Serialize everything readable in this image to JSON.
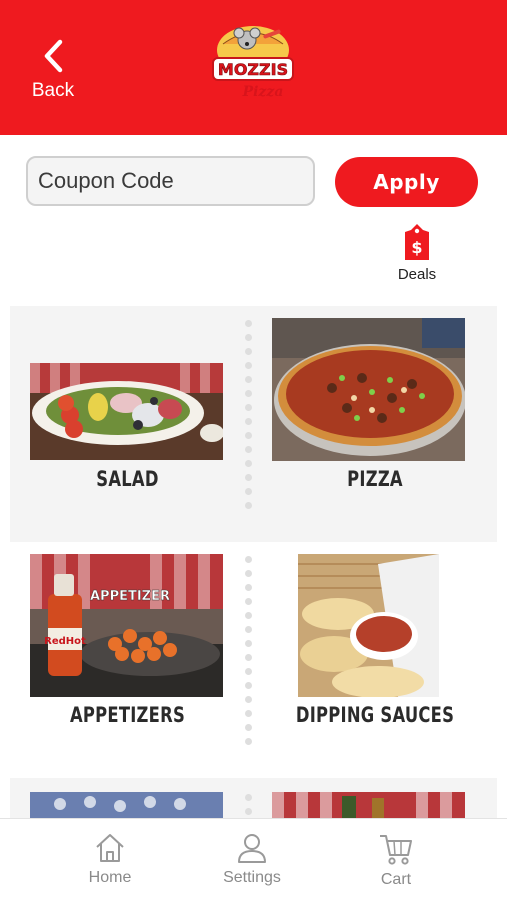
{
  "header": {
    "back_label": "Back",
    "logo_text": "MOZZIS",
    "logo_script": "Pizza",
    "brand_color": "#ef1a1f"
  },
  "coupon": {
    "placeholder": "Coupon Code",
    "apply_label": "Apply"
  },
  "deals": {
    "label": "Deals",
    "icon": "price-tag-dollar-icon"
  },
  "categories": [
    {
      "label": "SALAD"
    },
    {
      "label": "PIZZA"
    },
    {
      "label": "APPETIZERS",
      "photo_caption": "APPETIZER"
    },
    {
      "label": "DIPPING SAUCES"
    }
  ],
  "bottom_nav": {
    "items": [
      {
        "label": "Home",
        "icon": "home-icon"
      },
      {
        "label": "Settings",
        "icon": "person-icon"
      },
      {
        "label": "Cart",
        "icon": "cart-icon"
      }
    ]
  }
}
